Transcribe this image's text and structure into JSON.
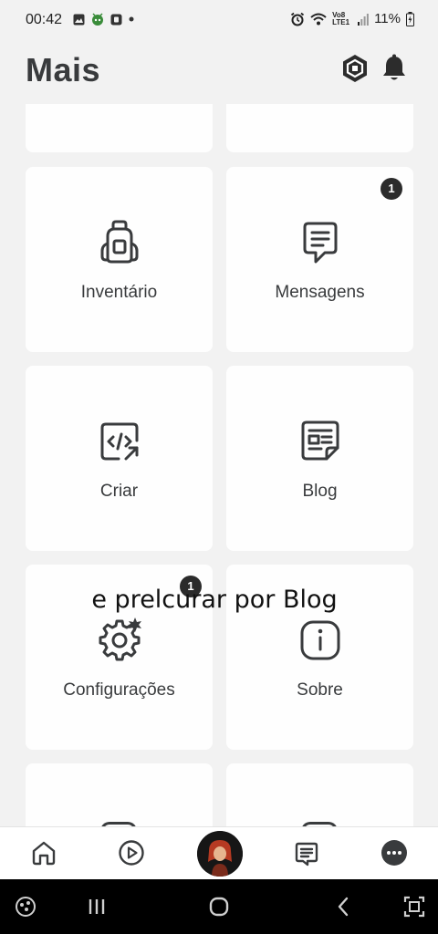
{
  "status_bar": {
    "time": "00:42",
    "network": "Vo8 LTE1",
    "battery": "11%"
  },
  "header": {
    "title": "Mais"
  },
  "tiles": [
    {
      "label": "Inventário",
      "icon": "backpack-icon"
    },
    {
      "label": "Mensagens",
      "icon": "messages-icon",
      "badge": "1"
    },
    {
      "label": "Criar",
      "icon": "create-code-icon"
    },
    {
      "label": "Blog",
      "icon": "blog-icon"
    },
    {
      "label": "Configurações",
      "icon": "settings-gear-icon",
      "badge": "1"
    },
    {
      "label": "Sobre",
      "icon": "info-icon"
    }
  ],
  "caption": "e prelcurar por Blog",
  "bottom_nav": [
    "home-icon",
    "discover-play-icon",
    "avatar",
    "chat-icon",
    "more-icon"
  ],
  "colors": {
    "background": "#f2f2f2",
    "tile": "#fefefe",
    "text": "#393b3d",
    "icon": "#393b3d",
    "badge": "#2b2b2b"
  }
}
